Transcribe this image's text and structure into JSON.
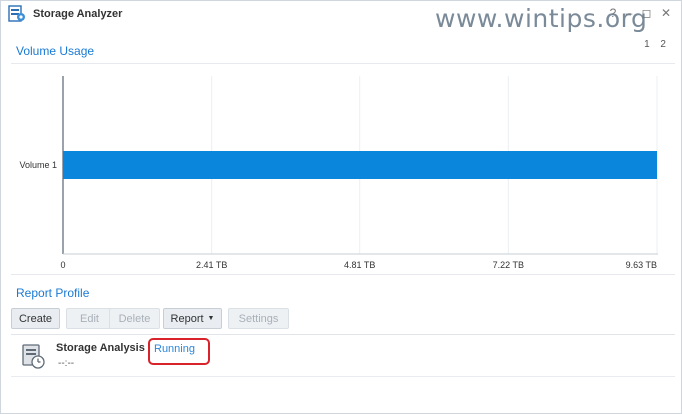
{
  "window": {
    "title": "Storage Analyzer",
    "watermark": "www.wintips.org",
    "controls": [
      "?",
      "–",
      "◻",
      "✕"
    ],
    "badges": "1 2"
  },
  "volume_usage": {
    "title": "Volume Usage"
  },
  "chart_data": {
    "type": "bar",
    "orientation": "horizontal",
    "categories": [
      "Volume 1"
    ],
    "values": [
      9.63
    ],
    "unit": "TB",
    "xlim": [
      0,
      9.63
    ],
    "ticks": [
      {
        "value": 0,
        "label": "0"
      },
      {
        "value": 2.41,
        "label": "2.41 TB"
      },
      {
        "value": 4.81,
        "label": "4.81 TB"
      },
      {
        "value": 7.22,
        "label": "7.22 TB"
      },
      {
        "value": 9.63,
        "label": "9.63 TB"
      }
    ],
    "bar_color": "#0a86dd",
    "grid": true
  },
  "report_profile": {
    "title": "Report Profile",
    "buttons": {
      "create": "Create",
      "edit": "Edit",
      "delete": "Delete",
      "report": "Report",
      "settings": "Settings"
    },
    "items": [
      {
        "name": "Storage Analysis",
        "status": "Running",
        "time": "--:--"
      }
    ]
  },
  "colors": {
    "accent": "#1a7ad4",
    "status_running": "#2b87da",
    "highlight": "#d9222a"
  }
}
